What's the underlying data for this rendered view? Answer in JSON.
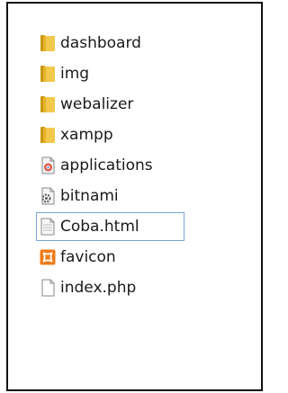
{
  "files": [
    {
      "name": "dashboard",
      "icon": "folder-icon",
      "type": "folder"
    },
    {
      "name": "img",
      "icon": "folder-icon",
      "type": "folder"
    },
    {
      "name": "webalizer",
      "icon": "folder-icon",
      "type": "folder"
    },
    {
      "name": "xampp",
      "icon": "folder-icon",
      "type": "folder"
    },
    {
      "name": "applications",
      "icon": "html-document-icon",
      "type": "file"
    },
    {
      "name": "bitnami",
      "icon": "settings-document-icon",
      "type": "file"
    },
    {
      "name": "Coba.html",
      "icon": "text-document-icon",
      "type": "file",
      "selected": true
    },
    {
      "name": "favicon",
      "icon": "xampp-logo-icon",
      "type": "file"
    },
    {
      "name": "index.php",
      "icon": "blank-document-icon",
      "type": "file"
    }
  ],
  "colors": {
    "folder": "#e8b92d",
    "selection_border": "#7aa3d8",
    "xampp_orange": "#f07c1a"
  }
}
